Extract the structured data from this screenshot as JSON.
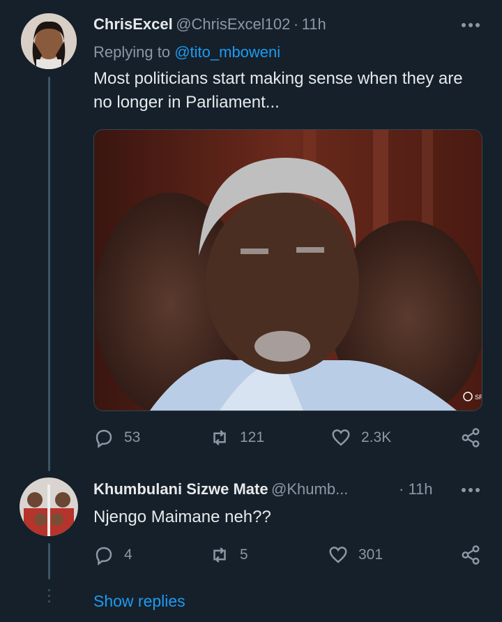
{
  "tweet": {
    "display_name": "ChrisExcel",
    "handle": "@ChrisExcel102",
    "separator": "·",
    "time": "11h",
    "replying_prefix": "Replying to",
    "replying_to": "@tito_mboweni",
    "text": "Most politicians start making sense when they are no longer in Parliament...",
    "image_watermark": "SR",
    "replies": "53",
    "retweets": "121",
    "likes": "2.3K"
  },
  "reply": {
    "display_name": "Khumbulani Sizwe Mate",
    "handle": "@Khumb...",
    "separator": "·",
    "time": "11h",
    "text": "Njengo Maimane neh??",
    "replies": "4",
    "retweets": "5",
    "likes": "301"
  },
  "show_replies_label": "Show replies",
  "colors": {
    "background": "#15202b",
    "accent": "#1d9bf0",
    "secondary_text": "#8b98a5"
  }
}
